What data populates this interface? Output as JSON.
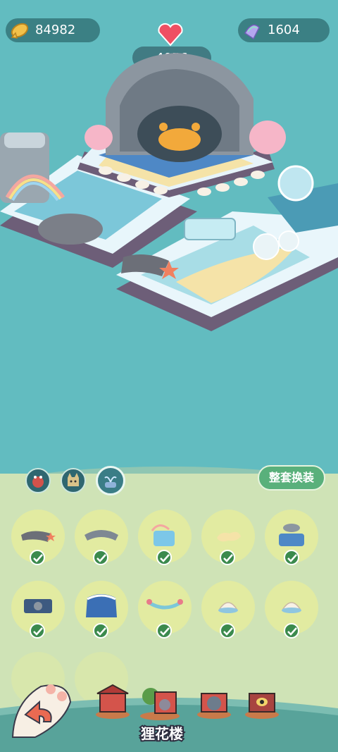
{
  "currency": {
    "coins": "84982",
    "gems": "1604",
    "hearts": "4056"
  },
  "panel": {
    "outfit_button_label": "整套换装",
    "tabs": [
      {
        "icon": "crab-theme-icon",
        "active": false
      },
      {
        "icon": "cat-theme-icon",
        "active": false
      },
      {
        "icon": "fountain-theme-icon",
        "active": true
      }
    ],
    "items": [
      {
        "icon": "starfish-rock-icon",
        "equipped": true
      },
      {
        "icon": "stone-bridge-icon",
        "equipped": true
      },
      {
        "icon": "rainbow-waterfall-icon",
        "equipped": true
      },
      {
        "icon": "sand-cushion-icon",
        "equipped": true
      },
      {
        "icon": "fountain-stage-icon",
        "equipped": true
      },
      {
        "icon": "shark-window-icon",
        "equipped": true
      },
      {
        "icon": "wave-arch-icon",
        "equipped": true
      },
      {
        "icon": "seaweed-garland-icon",
        "equipped": true
      },
      {
        "icon": "shell-seat-icon",
        "equipped": true
      },
      {
        "icon": "shell-seat-icon",
        "equipped": true
      }
    ]
  },
  "bottom_nav": {
    "selected_building": "狸花楼",
    "buildings": [
      {
        "icon": "red-pavilion-icon"
      },
      {
        "icon": "tree-house-icon"
      },
      {
        "icon": "gray-cat-house-icon"
      },
      {
        "icon": "eye-temple-icon"
      }
    ]
  },
  "colors": {
    "sea": "#62bcc0",
    "panel": "#cfe3b6",
    "button_green": "#59b07b",
    "check_green": "#3b8a4d"
  }
}
